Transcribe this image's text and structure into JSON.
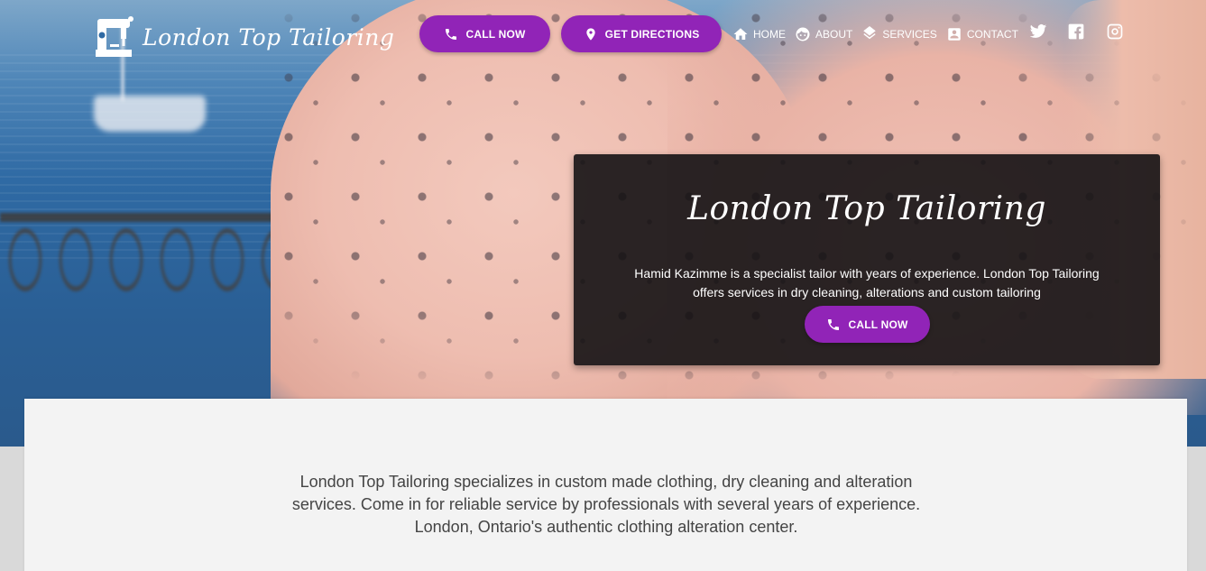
{
  "brand": {
    "name": "London Top Tailoring",
    "logo_icon": "sewing-machine-icon"
  },
  "header": {
    "call_button_label": "CALL NOW",
    "directions_button_label": "GET DIRECTIONS",
    "nav": [
      {
        "label": "HOME",
        "icon": "home-icon"
      },
      {
        "label": "ABOUT",
        "icon": "face-icon"
      },
      {
        "label": "SERVICES",
        "icon": "layers-icon"
      },
      {
        "label": "CONTACT",
        "icon": "contact-card-icon"
      }
    ],
    "social": [
      "twitter-icon",
      "facebook-icon",
      "instagram-icon"
    ]
  },
  "hero": {
    "title": "London Top Tailoring",
    "description": "Hamid Kazimme is a specialist tailor with years of experience. London Top Tailoring offers services in dry cleaning, alterations and custom tailoring",
    "button_label": "CALL NOW"
  },
  "content": {
    "intro": "London Top Tailoring specializes in custom made clothing, dry cleaning and alteration services. Come in for reliable service by professionals with several years of experience. London, Ontario's authentic clothing alteration center."
  },
  "colors": {
    "accent": "#9124b7",
    "card_bg": "#141214",
    "panel_bg": "#f3f3f3",
    "body_text": "#444444"
  }
}
